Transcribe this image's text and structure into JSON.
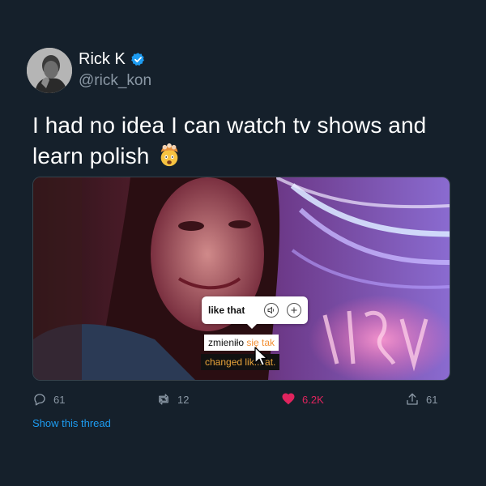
{
  "tweet": {
    "display_name": "Rick K",
    "handle": "@rick_kon",
    "text": "I had no idea I can watch tv shows and learn polish",
    "emoji_icon": "exploding-head-emoji"
  },
  "media": {
    "popup": {
      "word": "like that",
      "audio_icon": "speaker-icon",
      "add_icon": "plus-icon"
    },
    "subtitle_polish": {
      "plain": "zmieniło ",
      "highlight": "się tak"
    },
    "subtitle_english": "changed lik....at."
  },
  "actions": {
    "reply_count": "61",
    "retweet_count": "12",
    "like_count": "6.2K",
    "share_count": "61"
  },
  "show_thread_label": "Show this thread",
  "colors": {
    "background": "#15202b",
    "link": "#1d9bf0",
    "like": "#e0245e",
    "subtitle_highlight": "#f29035"
  }
}
